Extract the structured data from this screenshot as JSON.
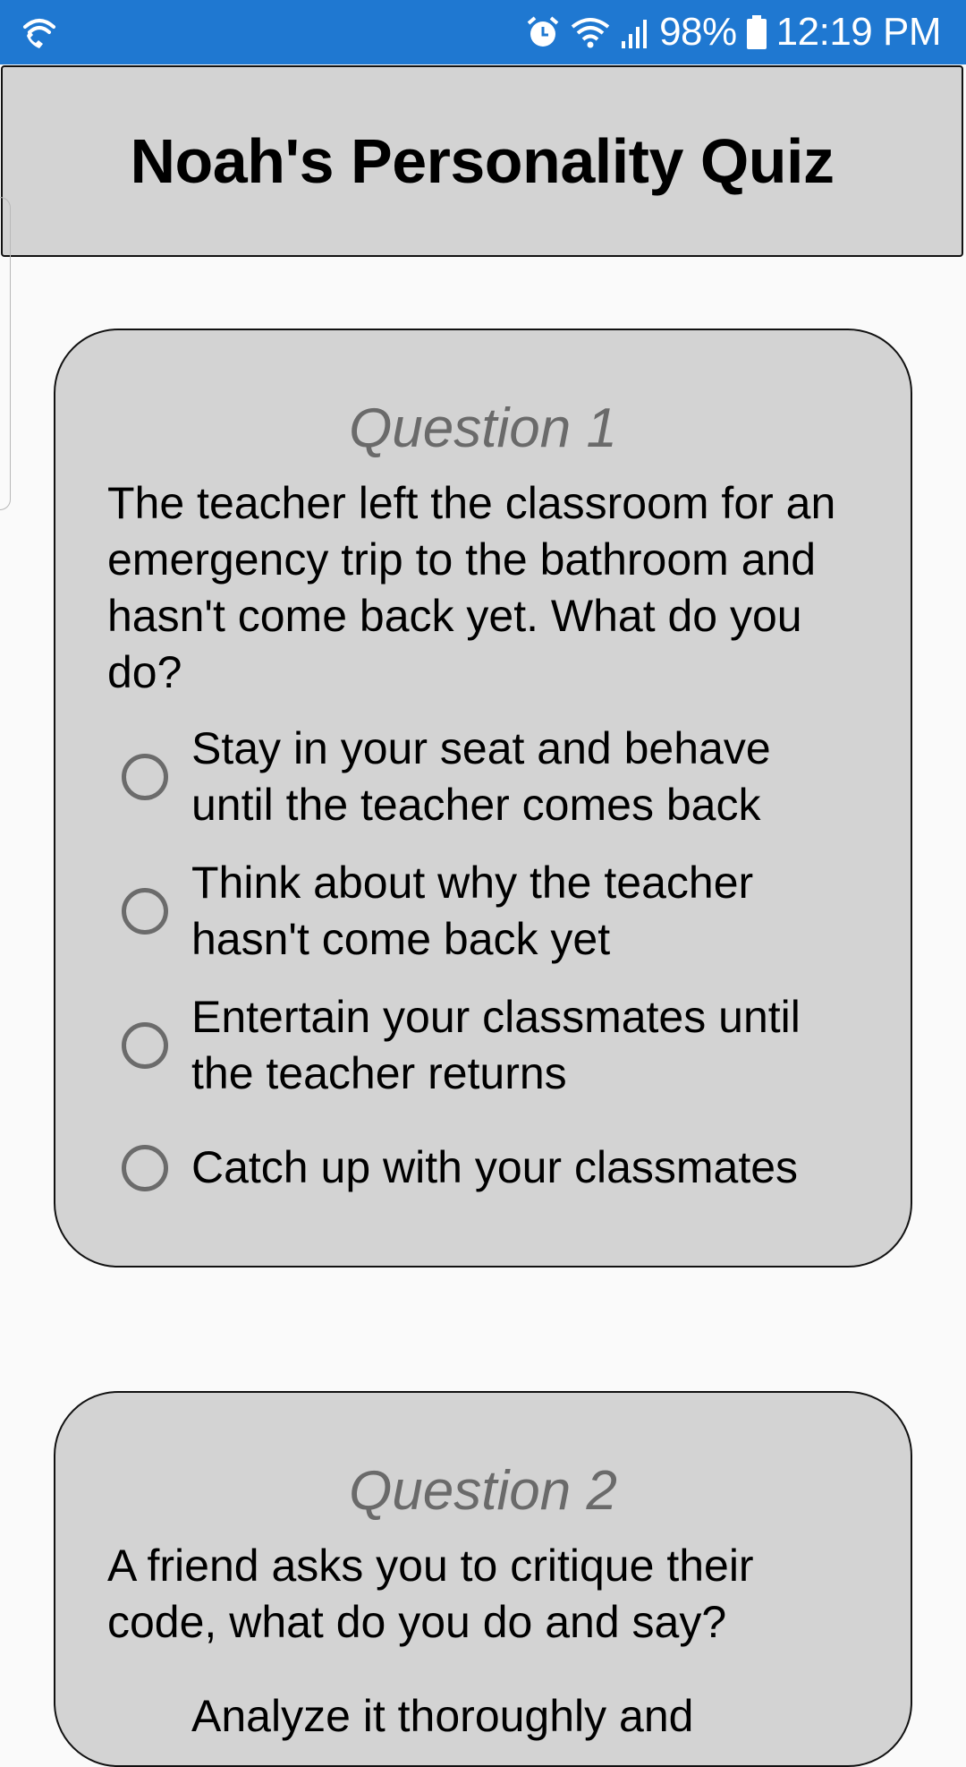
{
  "status_bar": {
    "battery_percent": "98%",
    "time": "12:19 PM",
    "icons": [
      "wifi-call-icon",
      "alarm-icon",
      "wifi-icon",
      "signal-icon",
      "battery-icon"
    ]
  },
  "header": {
    "title": "Noah's Personality Quiz"
  },
  "questions": [
    {
      "title": "Question 1",
      "text": "The teacher left the classroom for an emergency trip to the bathroom and hasn't come back yet. What do you do?",
      "options": [
        "Stay in your seat and behave until the teacher comes back",
        "Think about why the teacher hasn't come back yet",
        "Entertain your classmates until the teacher returns",
        "Catch up with your classmates"
      ]
    },
    {
      "title": "Question 2",
      "text": "A friend asks you to critique their code, what do you do and say?",
      "options": [
        "Analyze it thoroughly and"
      ]
    }
  ],
  "colors": {
    "status_bar": "#1f78d1",
    "card_bg": "#d3d3d3",
    "page_bg": "#fafafa",
    "question_title": "#6a6a6a"
  }
}
